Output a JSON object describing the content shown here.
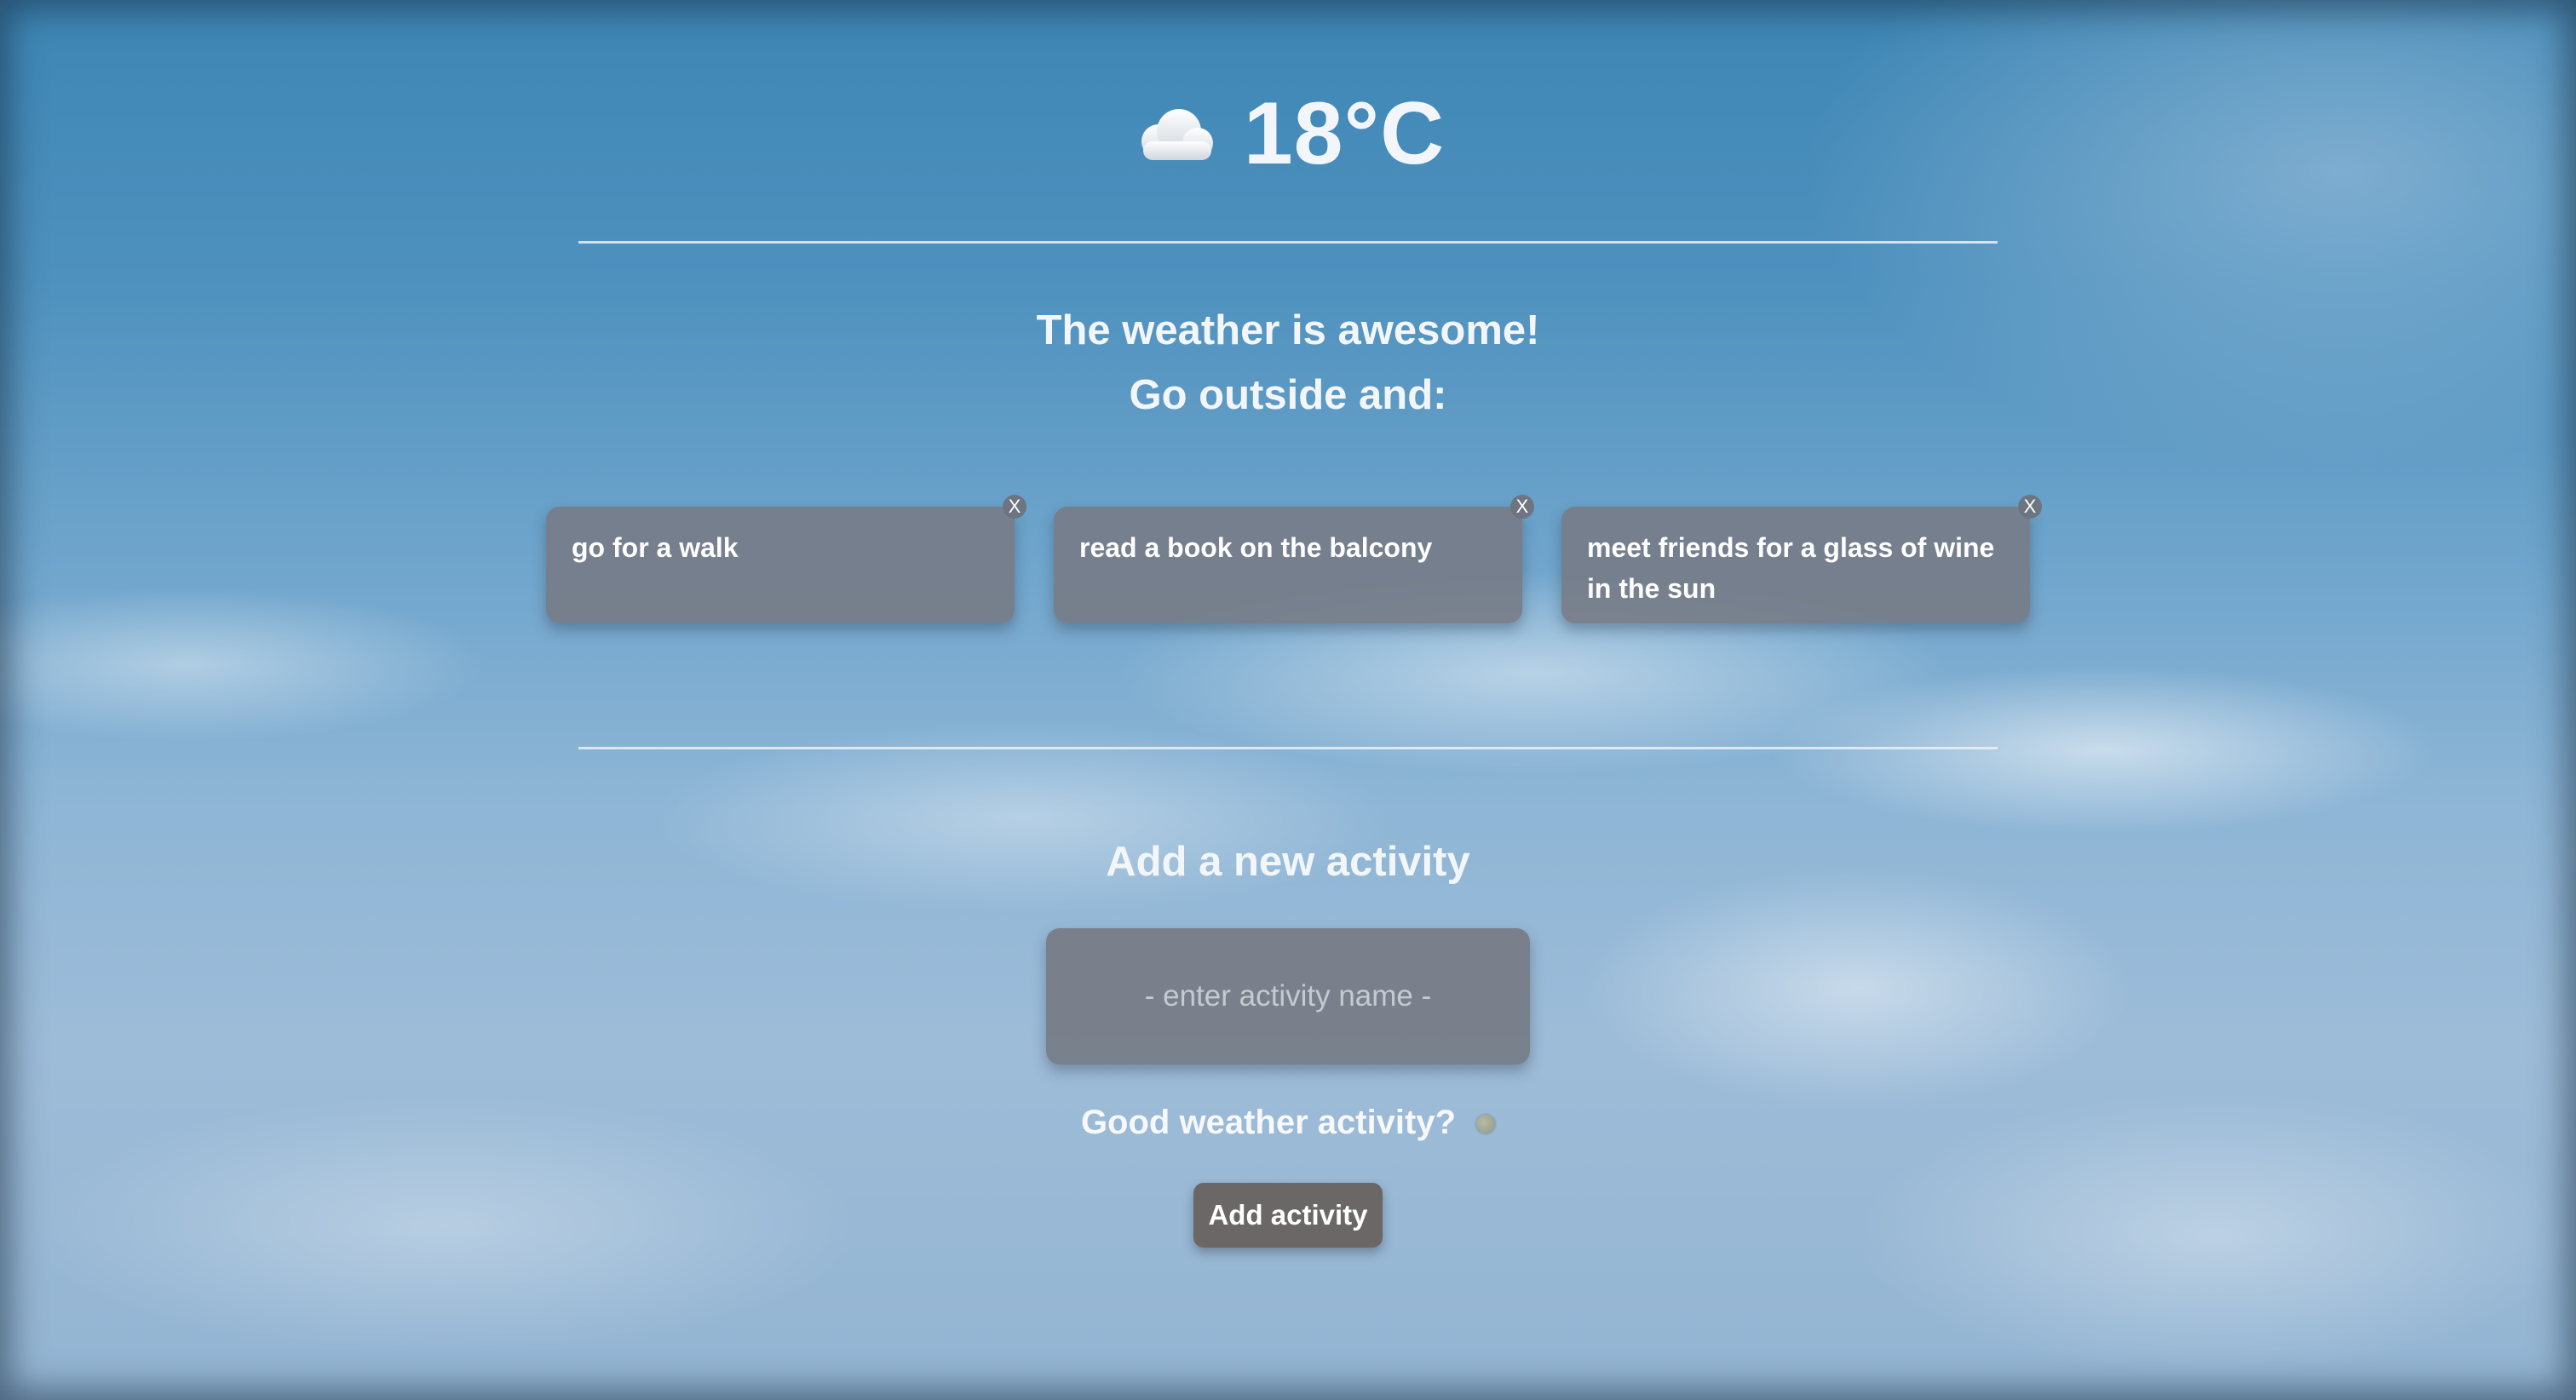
{
  "weather": {
    "icon": "cloud-icon",
    "temperature": "18°C"
  },
  "message": {
    "line1": "The weather is awesome!",
    "line2": "Go outside and:"
  },
  "activities": [
    {
      "label": "go for a walk",
      "close": "X"
    },
    {
      "label": "read a book on the balcony",
      "close": "X"
    },
    {
      "label": "meet friends for a glass of wine in the sun",
      "close": "X"
    }
  ],
  "form": {
    "title": "Add a new activity",
    "input_value": "",
    "input_placeholder": "- enter activity name -",
    "checkbox_label": "Good weather activity?",
    "checkbox_checked": false,
    "submit_label": "Add activity"
  }
}
